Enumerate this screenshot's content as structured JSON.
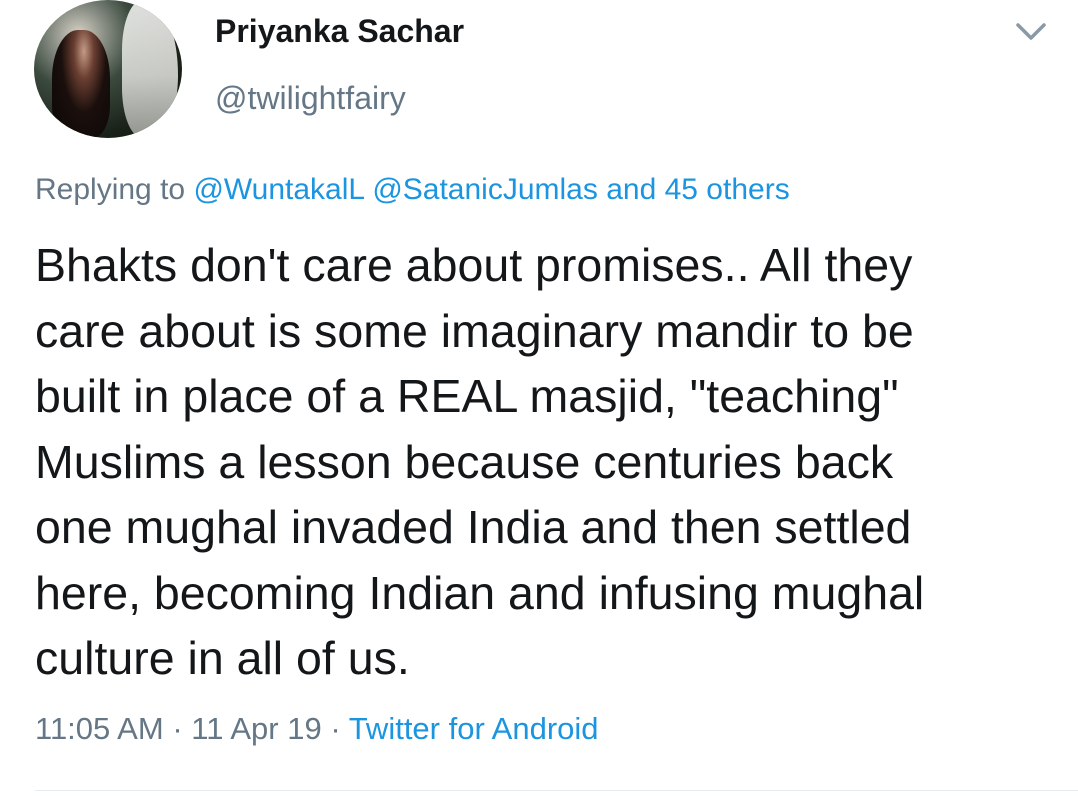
{
  "tweet": {
    "author": {
      "name": "Priyanka Sachar",
      "handle": "@twilightfairy"
    },
    "reply_context": {
      "prefix": "Replying to",
      "mention_1": "@WuntakalL",
      "mention_2": "@SatanicJumlas",
      "others": "and 45 others"
    },
    "text": "Bhakts don't care about promises.. All they\ncare about is some imaginary mandir to be\nbuilt in place of a REAL masjid, \"teaching\"\nMuslims a lesson because centuries back\none mughal invaded India and then settled\nhere, becoming Indian and infusing mughal\nculture in all of us.",
    "meta": {
      "time": "11:05 AM",
      "separator": "·",
      "date": "11 Apr 19",
      "source": "Twitter for Android"
    },
    "icons": {
      "menu": "chevron-down-icon"
    },
    "colors": {
      "link": "#1b95e0",
      "secondary": "#657786",
      "text": "#14171a"
    }
  }
}
